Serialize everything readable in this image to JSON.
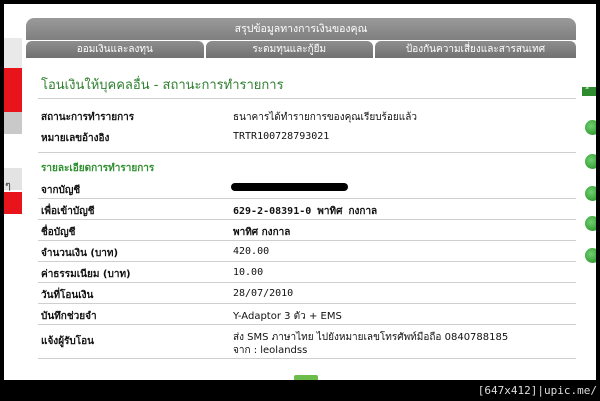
{
  "header": {
    "title": "สรุปข้อมูลทางการเงินของคุณ",
    "tabs": [
      {
        "label": "ออมเงินและลงทุน"
      },
      {
        "label": "ระดมทุนและกู้ยืม"
      },
      {
        "label": "ป้องกันความเสี่ยงและสารสนเทศ"
      }
    ]
  },
  "left_strip": {
    "char": "ๆ"
  },
  "right_strip": {
    "badge": "ื่"
  },
  "page": {
    "title": "โอนเงินให้บุคคลอื่น - สถานะการทำรายการ",
    "status_label": "สถานะการทำรายการ",
    "status_value": "ธนาคารได้ทำรายการของคุณเรียบร้อยแล้ว",
    "ref_label": "หมายเลขอ้างอิง",
    "ref_value": "TRTR100728793021"
  },
  "details": {
    "title": "รายละเอียดการทำรายการ",
    "from_account_label": "จากบัญชี",
    "to_account_label": "เพื่อเข้าบัญชี",
    "to_account_value": "629-2-08391-0 พาทิศ กงกาล",
    "account_name_label": "ชื่อบัญชี",
    "account_name_value": "พาทิศ กงกาล",
    "amount_label": "จำนวนเงิน (บาท)",
    "amount_value": "420.00",
    "fee_label": "ค่าธรรมเนียม (บาท)",
    "fee_value": "10.00",
    "date_label": "วันที่โอนเงิน",
    "date_value": "28/07/2010",
    "memo_label": "บันทึกช่วยจำ",
    "memo_value": "Y-Adaptor 3 ตัว + EMS",
    "notify_label": "แจ้งผู้รับโอน",
    "notify_line1": "ส่ง SMS ภาษาไทย ไปยังหมายเลขโทรศัพท์มือถือ 0840788185",
    "notify_line2": "จาก : leolandss"
  },
  "watermark": "[647x412]|upic.me/"
}
